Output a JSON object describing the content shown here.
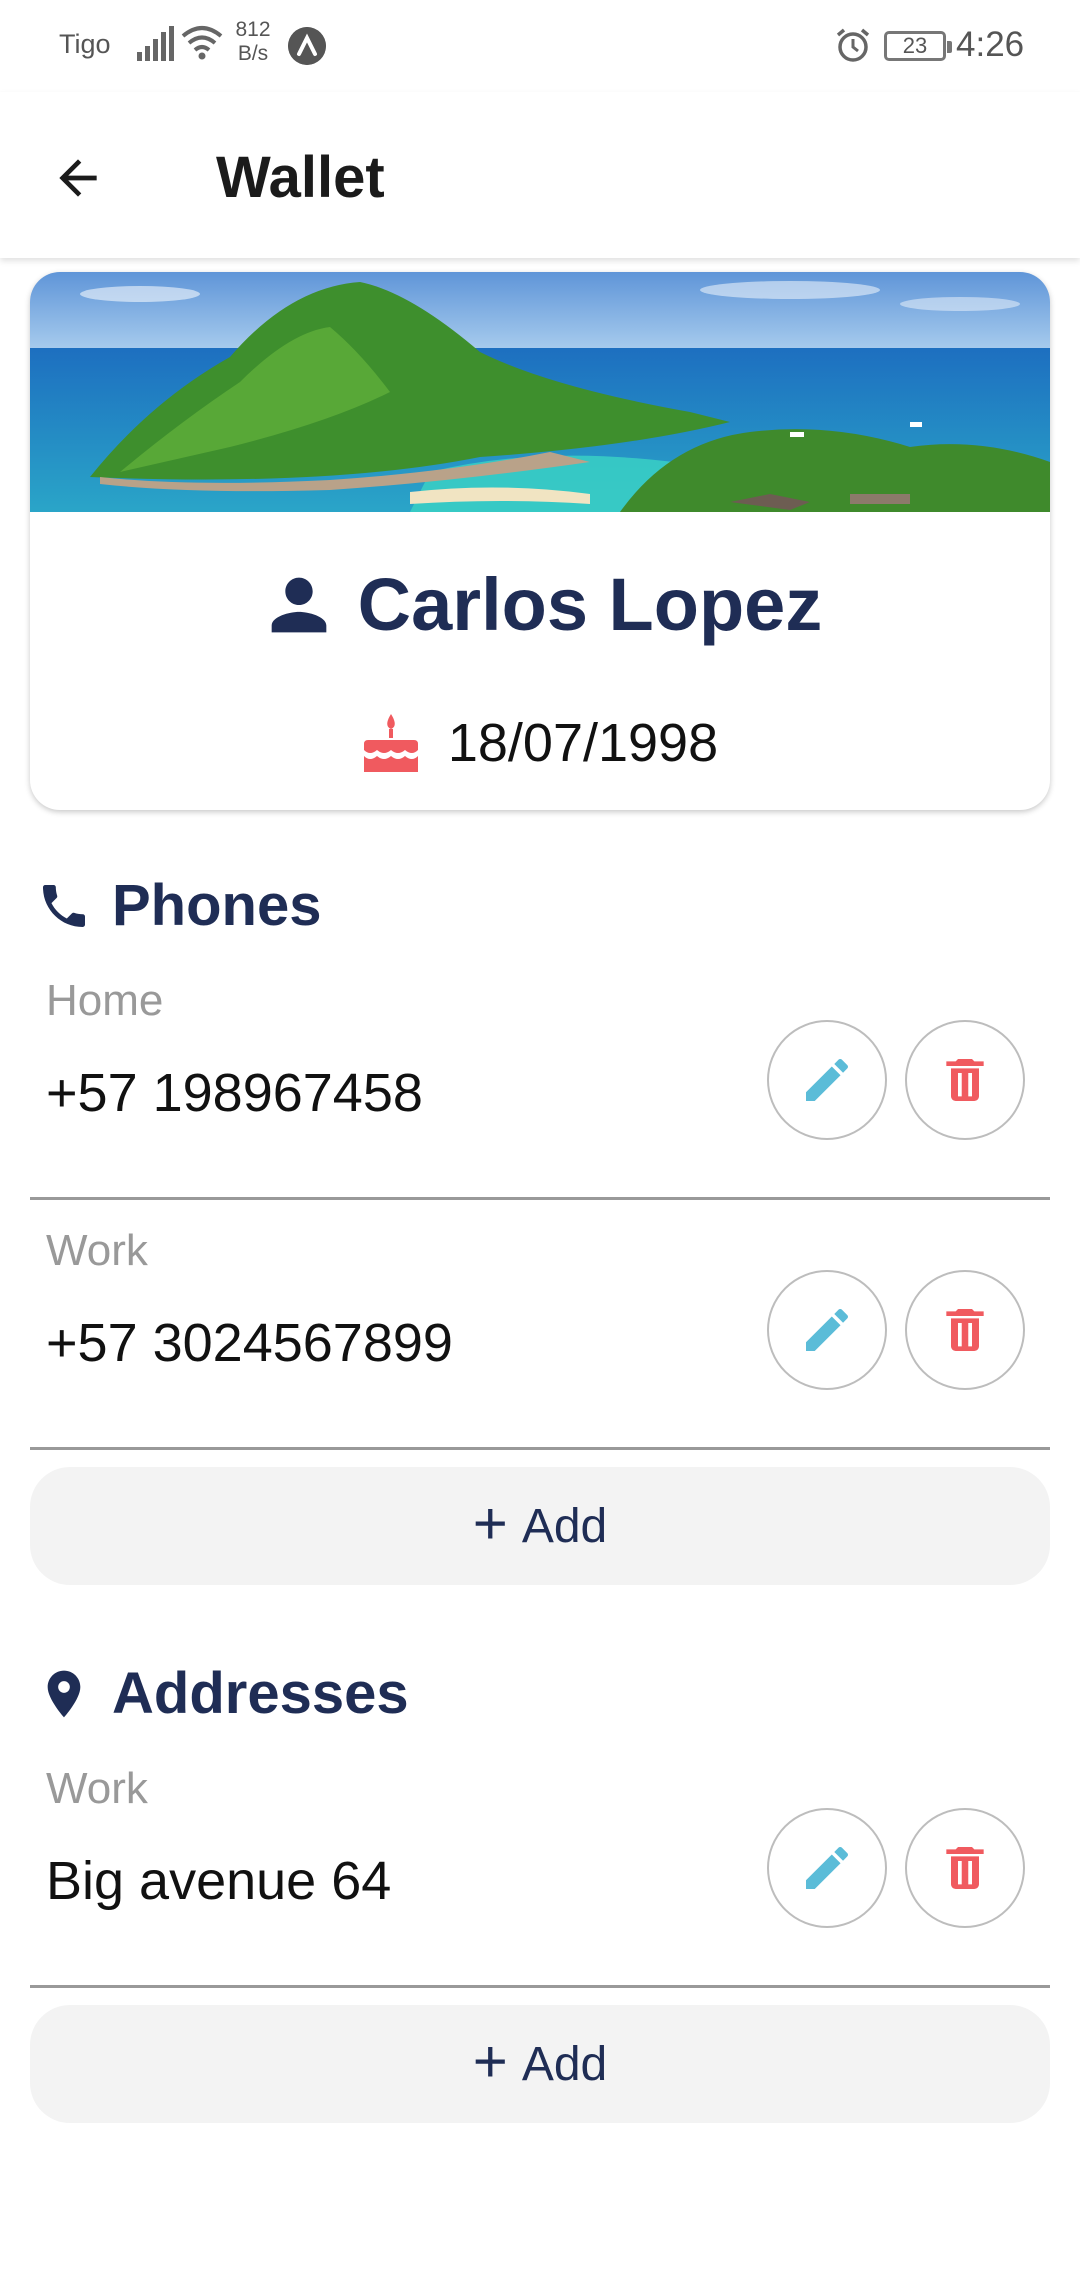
{
  "status_bar": {
    "carrier": "Tigo",
    "speed_value": "812",
    "speed_unit": "B/s",
    "battery": "23",
    "time": "4:26"
  },
  "app_bar": {
    "title": "Wallet",
    "back_icon": "arrow-left-icon"
  },
  "profile": {
    "name": "Carlos Lopez",
    "birthdate": "18/07/1998",
    "name_icon": "person-icon",
    "birth_icon": "cake-icon"
  },
  "phones": {
    "title": "Phones",
    "icon": "phone-icon",
    "items": [
      {
        "label": "Home",
        "value": "+57 198967458"
      },
      {
        "label": "Work",
        "value": "+57 3024567899"
      }
    ],
    "add_label": "Add"
  },
  "addresses": {
    "title": "Addresses",
    "icon": "location-pin-icon",
    "items": [
      {
        "label": "Work",
        "value": "Big avenue 64"
      }
    ],
    "add_label": "Add"
  },
  "colors": {
    "navy": "#1f2d55",
    "edit_blue": "#5bbcd8",
    "delete_red": "#f05a5f"
  }
}
